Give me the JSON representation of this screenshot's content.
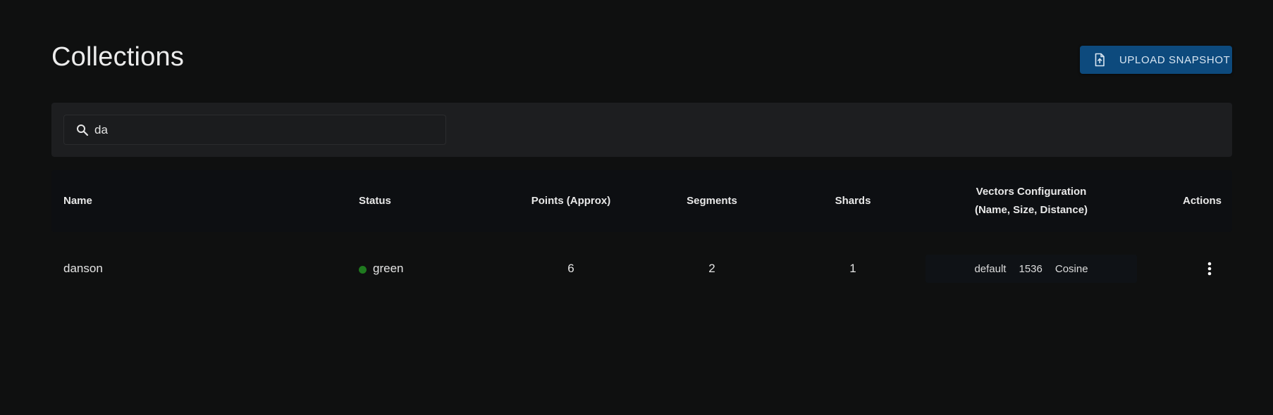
{
  "page": {
    "title": "Collections"
  },
  "toolbar": {
    "upload_label": "UPLOAD SNAPSHOT",
    "upload_icon": "file-upload-icon"
  },
  "search": {
    "value": "da",
    "icon": "search-icon"
  },
  "table": {
    "columns": {
      "name": "Name",
      "status": "Status",
      "points": "Points (Approx)",
      "segments": "Segments",
      "shards": "Shards",
      "vectors_line1": "Vectors Configuration",
      "vectors_line2": "(Name, Size, Distance)",
      "actions": "Actions"
    },
    "rows": [
      {
        "name": "danson",
        "status": "green",
        "status_color": "#1f7a1f",
        "points": "6",
        "segments": "2",
        "shards": "1",
        "vector_name": "default",
        "vector_size": "1536",
        "vector_distance": "Cosine",
        "actions_icon": "more-vert-icon"
      }
    ]
  },
  "colors": {
    "background": "#0f1010",
    "panel": "#1d1e20",
    "header_row": "#0d0f12",
    "accent": "#0d4a7d"
  }
}
